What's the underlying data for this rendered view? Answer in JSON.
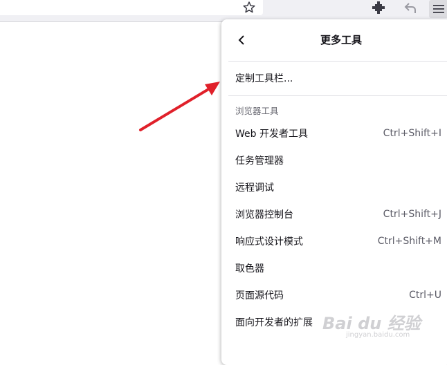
{
  "toolbar": {
    "icons": [
      "star-icon",
      "extensions-icon",
      "back-arrow-icon",
      "hamburger-menu-icon"
    ]
  },
  "panel": {
    "title": "更多工具",
    "customize_label": "定制工具栏...",
    "section_label": "浏览器工具",
    "items": [
      {
        "label": "Web 开发者工具",
        "shortcut": "Ctrl+Shift+I"
      },
      {
        "label": "任务管理器",
        "shortcut": ""
      },
      {
        "label": "远程调试",
        "shortcut": ""
      },
      {
        "label": "浏览器控制台",
        "shortcut": "Ctrl+Shift+J"
      },
      {
        "label": "响应式设计模式",
        "shortcut": "Ctrl+Shift+M"
      },
      {
        "label": "取色器",
        "shortcut": ""
      },
      {
        "label": "页面源代码",
        "shortcut": "Ctrl+U"
      },
      {
        "label": "面向开发者的扩展",
        "shortcut": ""
      }
    ]
  },
  "annotation": {
    "arrow_color": "#e0202a"
  },
  "watermark": {
    "brand": "Bai du 经验",
    "url": "jingyan.baidu.com"
  }
}
